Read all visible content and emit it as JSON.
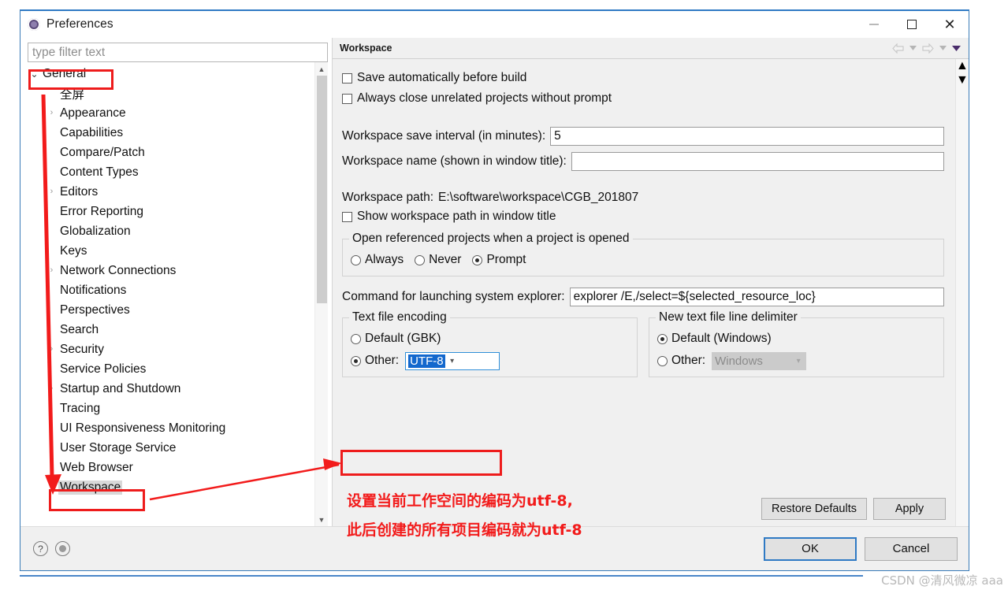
{
  "window": {
    "title": "Preferences",
    "icon": "preferences-icon",
    "controls": {
      "minimize": "minimize-icon",
      "maximize": "maximize-icon",
      "close": "close-icon"
    }
  },
  "sidebar": {
    "filter_placeholder": "type filter text",
    "items": [
      {
        "label": "General",
        "level": 1,
        "twisty": "open",
        "selected": false
      },
      {
        "label": "全屏",
        "level": 2,
        "twisty": "none",
        "selected": false
      },
      {
        "label": "Appearance",
        "level": 2,
        "twisty": "collapsed",
        "selected": false
      },
      {
        "label": "Capabilities",
        "level": 2,
        "twisty": "none",
        "selected": false
      },
      {
        "label": "Compare/Patch",
        "level": 2,
        "twisty": "none",
        "selected": false
      },
      {
        "label": "Content Types",
        "level": 2,
        "twisty": "none",
        "selected": false
      },
      {
        "label": "Editors",
        "level": 2,
        "twisty": "collapsed",
        "selected": false
      },
      {
        "label": "Error Reporting",
        "level": 2,
        "twisty": "none",
        "selected": false
      },
      {
        "label": "Globalization",
        "level": 2,
        "twisty": "none",
        "selected": false
      },
      {
        "label": "Keys",
        "level": 2,
        "twisty": "none",
        "selected": false
      },
      {
        "label": "Network Connections",
        "level": 2,
        "twisty": "collapsed",
        "selected": false
      },
      {
        "label": "Notifications",
        "level": 2,
        "twisty": "none",
        "selected": false
      },
      {
        "label": "Perspectives",
        "level": 2,
        "twisty": "none",
        "selected": false
      },
      {
        "label": "Search",
        "level": 2,
        "twisty": "none",
        "selected": false
      },
      {
        "label": "Security",
        "level": 2,
        "twisty": "collapsed",
        "selected": false
      },
      {
        "label": "Service Policies",
        "level": 2,
        "twisty": "none",
        "selected": false
      },
      {
        "label": "Startup and Shutdown",
        "level": 2,
        "twisty": "collapsed",
        "selected": false
      },
      {
        "label": "Tracing",
        "level": 2,
        "twisty": "none",
        "selected": false
      },
      {
        "label": "UI Responsiveness Monitoring",
        "level": 2,
        "twisty": "none",
        "selected": false
      },
      {
        "label": "User Storage Service",
        "level": 2,
        "twisty": "none",
        "selected": false
      },
      {
        "label": "Web Browser",
        "level": 2,
        "twisty": "none",
        "selected": false
      },
      {
        "label": "Workspace",
        "level": 2,
        "twisty": "collapsed",
        "selected": true
      }
    ],
    "scroll_up_icon": "chevron-up-icon",
    "scroll_down_icon": "chevron-down-icon"
  },
  "panel": {
    "title": "Workspace",
    "nav": {
      "back_icon": "back-arrow-icon",
      "back_menu_icon": "chevron-down-icon",
      "forward_icon": "forward-arrow-icon",
      "forward_menu_icon": "chevron-down-icon",
      "view_menu_icon": "view-menu-icon"
    },
    "checkboxes": [
      {
        "label": "Save automatically before build",
        "checked": false
      },
      {
        "label": "Always close unrelated projects without prompt",
        "checked": false
      }
    ],
    "save_interval": {
      "label": "Workspace save interval (in minutes):",
      "value": "5"
    },
    "workspace_name": {
      "label": "Workspace name (shown in window title):",
      "value": ""
    },
    "workspace_path": {
      "label": "Workspace path:",
      "value": "E:\\software\\workspace\\CGB_201807"
    },
    "show_path_checkbox": {
      "label": "Show workspace path in window title",
      "checked": false
    },
    "open_referenced": {
      "group_title": "Open referenced projects when a project is opened",
      "options": [
        {
          "label": "Always",
          "selected": false
        },
        {
          "label": "Never",
          "selected": false
        },
        {
          "label": "Prompt",
          "selected": true
        }
      ]
    },
    "explorer_command": {
      "label": "Command for launching system explorer:",
      "value": "explorer /E,/select=${selected_resource_loc}"
    },
    "text_file_encoding": {
      "group_title": "Text file encoding",
      "default_option": {
        "label": "Default (GBK)",
        "selected": false
      },
      "other_option": {
        "label": "Other:",
        "selected": true
      },
      "combo_value": "UTF-8",
      "combo_focused": true,
      "combo_arrow_icon": "chevron-down-icon"
    },
    "line_delimiter": {
      "group_title": "New text file line delimiter",
      "default_option": {
        "label": "Default (Windows)",
        "selected": true
      },
      "other_option": {
        "label": "Other:",
        "selected": false
      },
      "combo_value": "Windows",
      "combo_disabled": true,
      "combo_arrow_icon": "chevron-down-icon"
    },
    "restore_defaults_label": "Restore Defaults",
    "apply_label": "Apply",
    "scroll_up_icon": "chevron-up-icon",
    "scroll_down_icon": "chevron-down-icon"
  },
  "footer": {
    "help_icon": "help-icon",
    "secondary_icon": "circle-dot-icon",
    "ok_label": "OK",
    "cancel_label": "Cancel"
  },
  "annotations": {
    "line1": "设置当前工作空间的编码为utf-8,",
    "line2": "此后创建的所有项目编码就为utf-8",
    "watermark": "CSDN @清风微凉 aaa",
    "highlight_color": "#ee1c1c"
  }
}
